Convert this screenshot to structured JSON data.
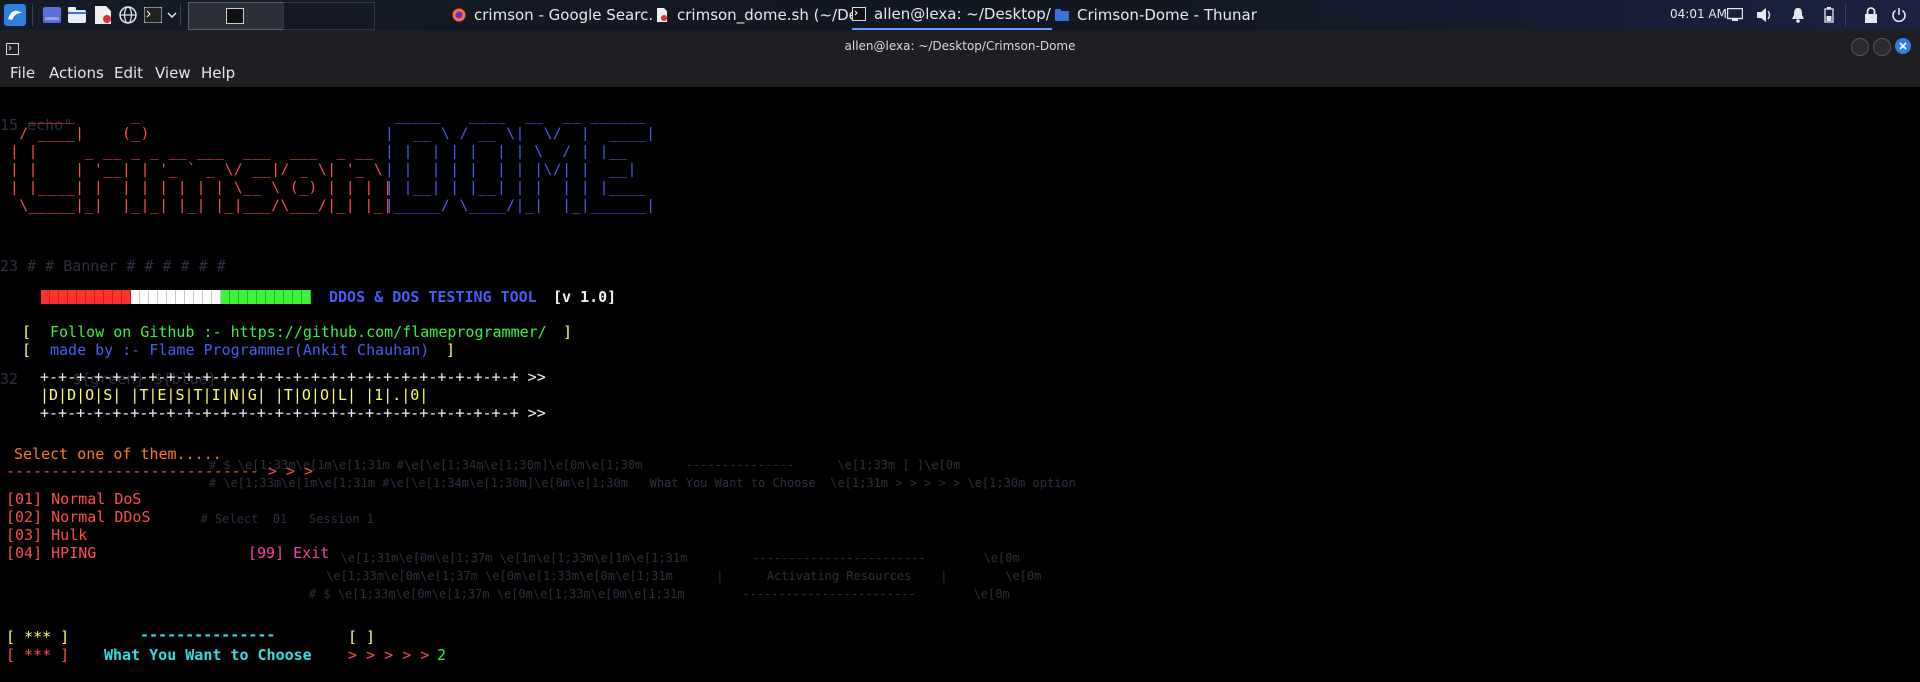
{
  "taskbar": {
    "windows": [
      {
        "title": "crimson - Google Searc...",
        "icon": "firefox-icon"
      },
      {
        "title": "crimson_dome.sh (~/De...",
        "icon": "text-editor-icon"
      },
      {
        "title": "allen@lexa: ~/Desktop/...",
        "icon": "terminal-icon"
      },
      {
        "title": "Crimson-Dome - Thunar",
        "icon": "folder-icon"
      }
    ],
    "clock": "04:01 AM"
  },
  "window": {
    "title": "allen@lexa: ~/Desktop/Crimson-Dome"
  },
  "menu": [
    "File",
    "Actions",
    "Edit",
    "View",
    "Help"
  ],
  "terminal": {
    "ascii_crimson": [
      "  _____      _",
      " / ____|    (_)",
      "| |     _ __ _ _ __ ___  ___  ___  _ __",
      "| |    | '__| | '_ ` _ \\/ __|/ _ \\| '_ \\",
      "| |____| |  | | | | | | \\__ \\ (_) | | | |",
      " \\_____|_|  |_|_| |_| |_|___/\\___/|_| |_|"
    ],
    "ascii_dome": [
      " _____   ____  __  __ ______",
      "|  __ \\ / __ \\|  \\/  |  ____|",
      "| |  | | |  | | \\  / | |__",
      "| |  | | |  | | |\\/| |  __|",
      "| |__| | |__| | |  | | |____",
      "|_____/ \\____/|_|  |_|______|"
    ],
    "tool_title": "DDOS & DOS TESTING TOOL",
    "version": "[v 1.0]",
    "follow_open": "[",
    "follow_text": "Follow on Github :- https://github.com/flameprogrammer/",
    "follow_close": "]",
    "made_open": "[",
    "made_text": "made by :- Flame Programmer(Ankit Chauhan)",
    "made_close": "]",
    "banner_border": "+-+-+-+-+-+-+-+-+-+-+-+-+-+-+-+-+-+-+-+-+-+-+-+-+-+-+ >>",
    "banner_text": "|D|D|O|S| |T|E|S|T|I|N|G| |T|O|O|L| |1|.|0|",
    "select_prompt": "Select one of them.....",
    "dash_arrow": "---------------------------- > > >",
    "options": [
      "[01] Normal DoS",
      "[02] Normal DDoS",
      "[03] Hulk",
      "[04] HPING"
    ],
    "exit_option": "[99] Exit",
    "stars_line1_open": "[ *** ]",
    "stars_line1_dashes": "---------------",
    "stars_line1_bracket": "[ ]",
    "stars_line2_open": "[ *** ]",
    "choose_label": "What You Want to Choose",
    "choose_arrows": "> > > > >",
    "choose_value": "2",
    "ghost_lines": [
      "15 echo\"",
      "23 # # Banner # # # # # #",
      "32      ${green} ${blue}",
      "    # $ \\e[1;33m\\e[1m\\e[1;31m #\\e[\\e[1;34m\\e[1;30m]\\e[0m\\e[1;30m      ---------------      \\e[1;33m [ ]\\e[0m",
      "    # \\e[1;33m\\e[1m\\e[1;31m #\\e[\\e[1;34m\\e[1;30m]\\e[0m\\e[1;30m   What You Want to Choose  \\e[1;31m > > > > > \\e[1;30m option",
      "       # Select  01   Session 1",
      "       \\e[1;31m\\e[0m\\e[1;37m \\e[1m\\e[1;33m\\e[1m\\e[1;31m         ------------------------        \\e[0m",
      "     \\e[1;33m\\e[0m\\e[1;37m \\e[0m\\e[1;33m\\e[0m\\e[1;31m      |      Activating Resources    |        \\e[0m",
      "    # $ \\e[1;33m\\e[0m\\e[1;37m \\e[0m\\e[1;33m\\e[0m\\e[1;31m        ------------------------        \\e[0m"
    ]
  },
  "colors": {
    "terminal_bg": "#000000",
    "accent_red": "#ff4d4d",
    "accent_blue": "#4b5cf5",
    "accent_yellow": "#ffff66",
    "accent_green": "#3ef23e",
    "accent_cyan": "#33dede",
    "accent_orange": "#ff7a1a",
    "accent_pink": "#ff3ea0"
  }
}
